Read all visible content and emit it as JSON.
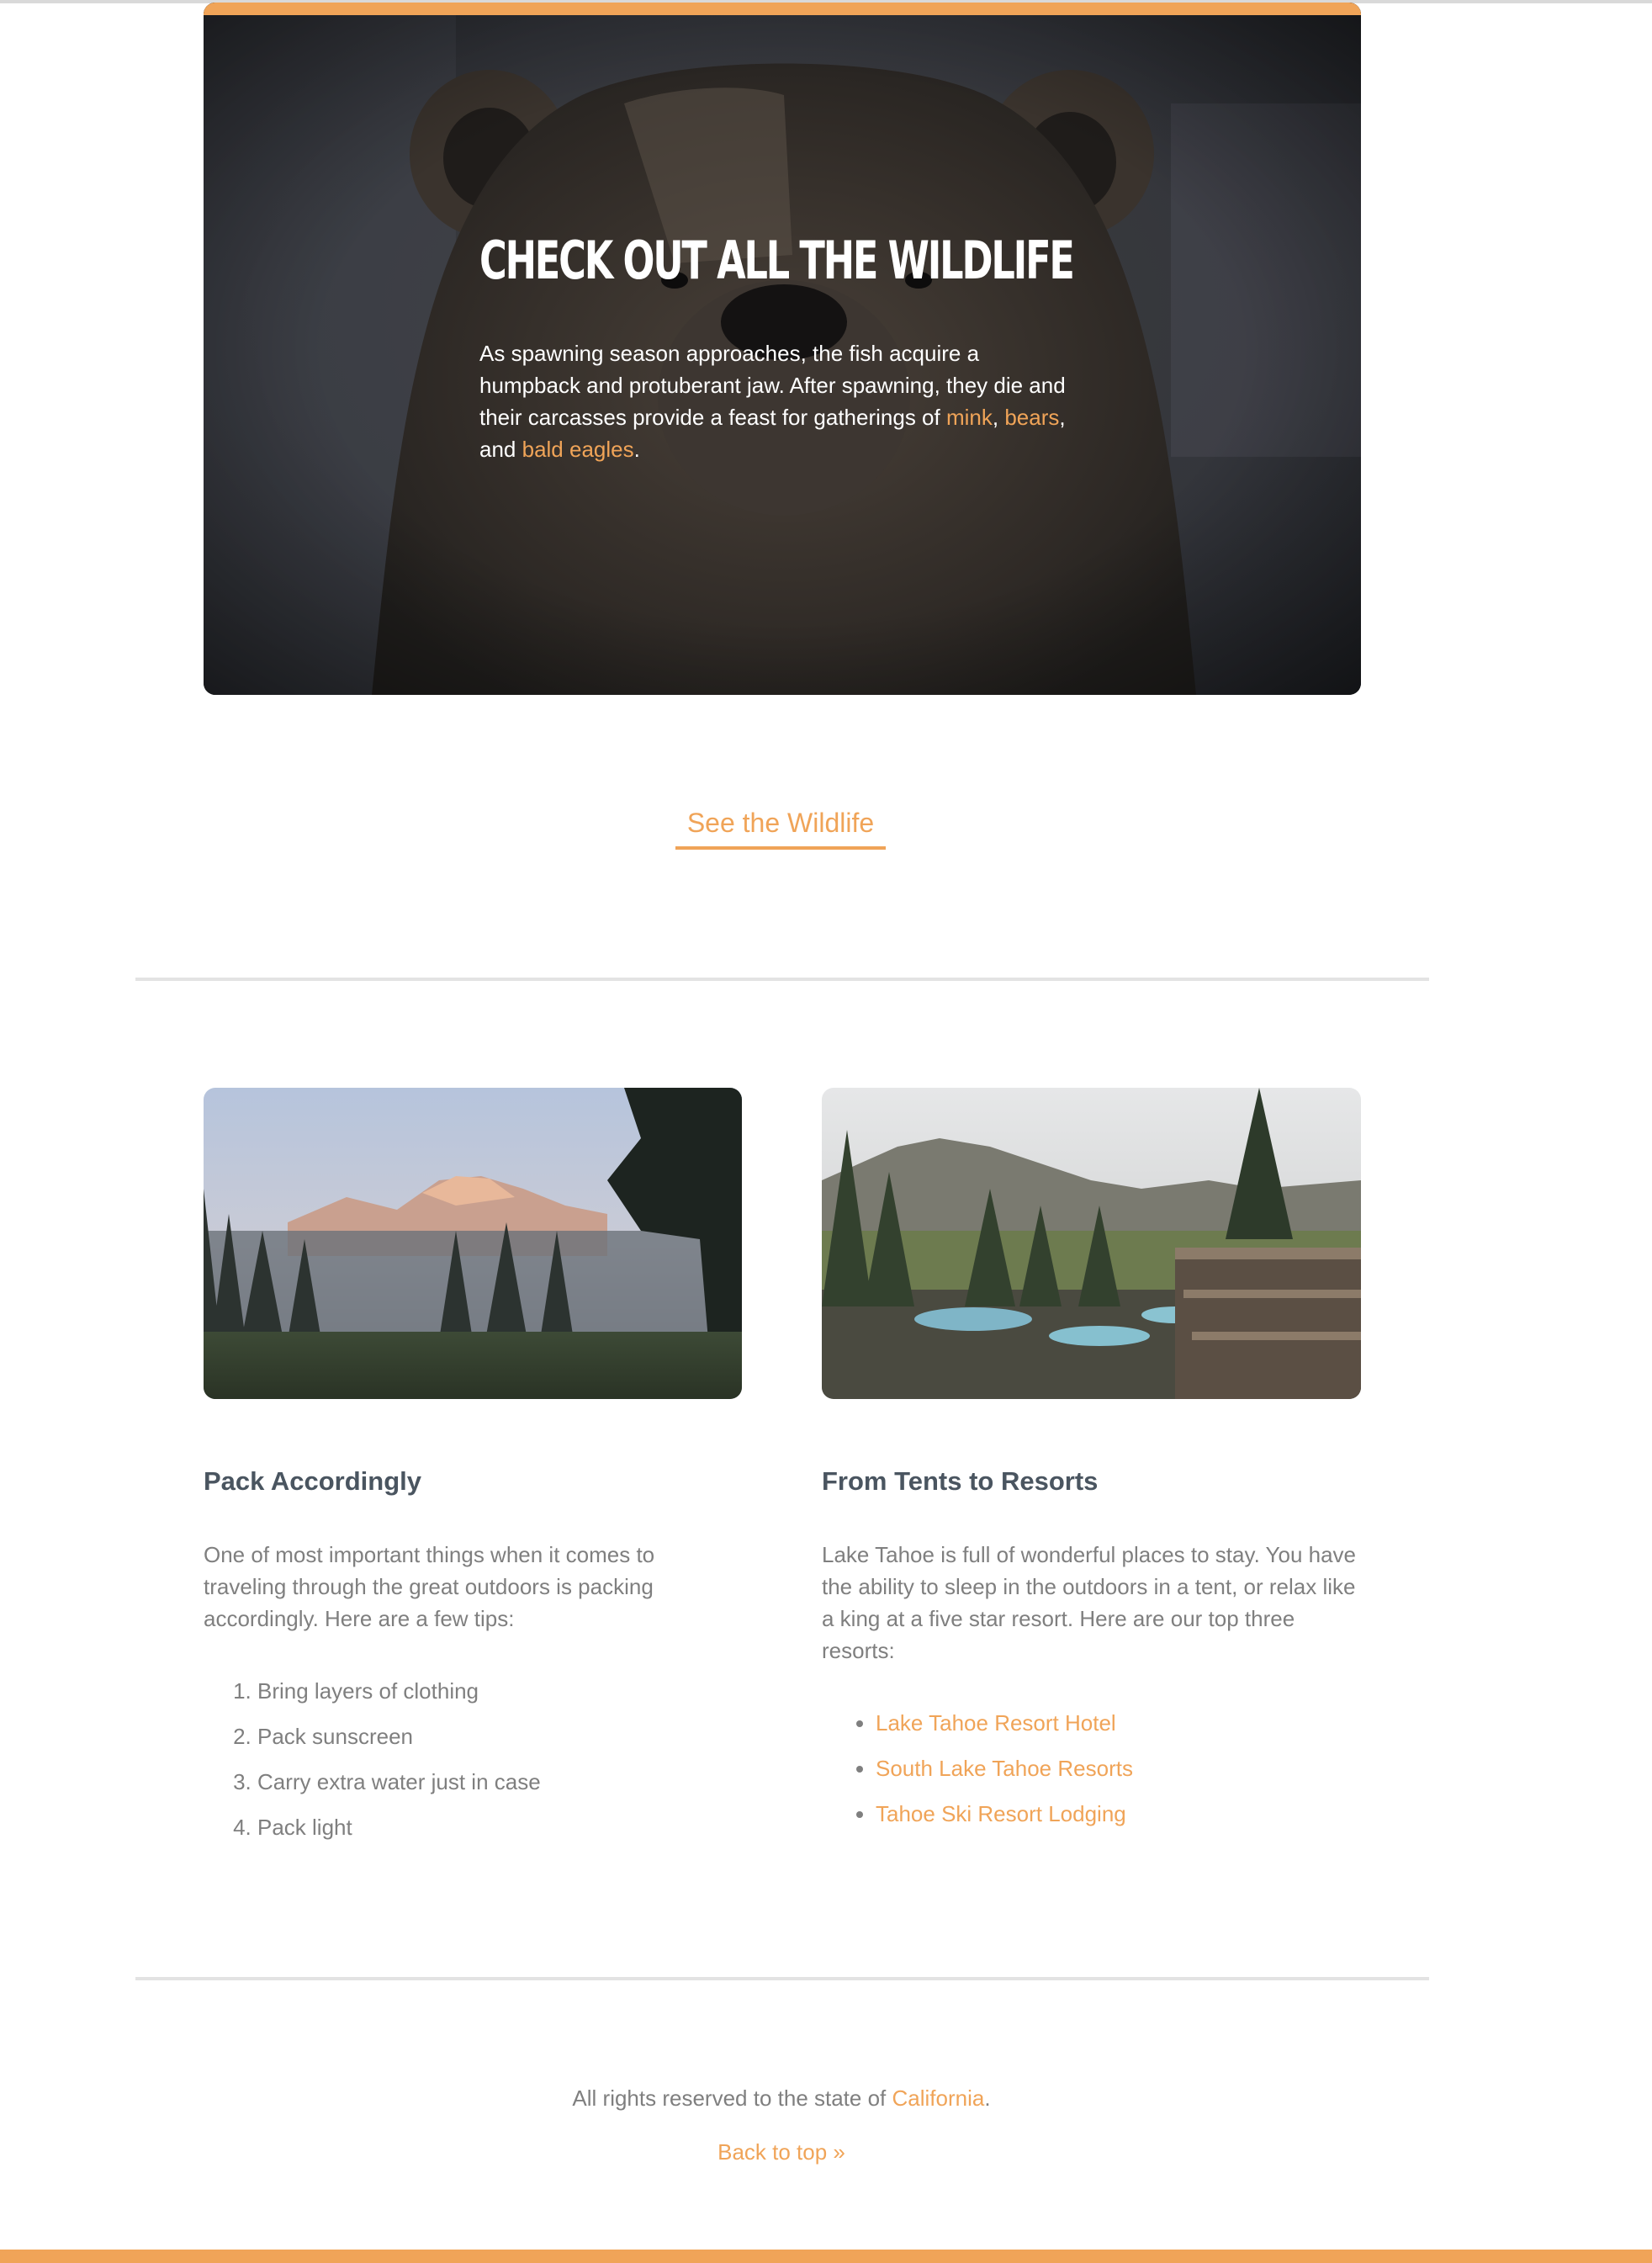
{
  "hero": {
    "title": "CHECK OUT ALL THE WILDLIFE",
    "body_before": "As spawning season approaches, the fish acquire a humpback and protuberant jaw. After spawning, they die and their carcasses provide a feast for gatherings of ",
    "link_mink": "mink",
    "sep1": ", ",
    "link_bears": "bears",
    "sep2": ", and ",
    "link_eagles": "bald eagles",
    "end": ".",
    "image_icon": "bear-photo"
  },
  "cta": {
    "label": "See the Wildlife"
  },
  "left_column": {
    "image_icon": "misty-forest-photo",
    "heading": "Pack Accordingly",
    "text": "One of most important things when it comes to traveling through the great outdoors is packing accordingly. Here are a few tips:",
    "tips": [
      "Bring layers of clothing",
      "Pack sunscreen",
      "Carry extra water just in case",
      "Pack light"
    ]
  },
  "right_column": {
    "image_icon": "resort-pool-photo",
    "heading": "From Tents to Resorts",
    "text": "Lake Tahoe is full of wonderful places to stay. You have the ability to sleep in the outdoors in a tent, or relax like a king at a five star resort. Here are our top three resorts:",
    "resorts": [
      "Lake Tahoe Resort Hotel",
      "South Lake Tahoe Resorts",
      "Tahoe Ski Resort Lodging"
    ]
  },
  "footer": {
    "rights_before": "All rights reserved to the state of ",
    "rights_link": "California",
    "rights_end": ".",
    "back_to_top": "Back to top »"
  },
  "colors": {
    "accent": "#f0a458",
    "heading": "#4a5560",
    "body_text": "#7f7f7f",
    "divider": "#e3e3e3"
  }
}
